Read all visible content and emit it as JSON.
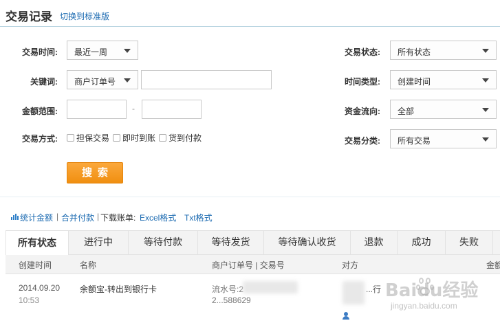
{
  "header": {
    "title": "交易记录",
    "switch_link": "切换到标准版"
  },
  "filters": {
    "time_label": "交易时间:",
    "time_value": "最近一周",
    "keyword_label": "关键词:",
    "keyword_type": "商户订单号",
    "keyword_value": "",
    "amount_label": "金额范围:",
    "amount_min": "",
    "amount_max": "",
    "amount_separator": "-",
    "method_label": "交易方式:",
    "methods": [
      "担保交易",
      "即时到账",
      "货到付款"
    ],
    "status_label": "交易状态:",
    "status_value": "所有状态",
    "timetype_label": "时间类型:",
    "timetype_value": "创建时间",
    "flow_label": "资金流向:",
    "flow_value": "全部",
    "category_label": "交易分类:",
    "category_value": "所有交易",
    "search_button": "搜索"
  },
  "toolbar": {
    "stats": "统计金额",
    "sep1": "|",
    "merge_pay": "合并付款",
    "sep2": "|",
    "download_label": "下载账单:",
    "excel": "Excel格式",
    "txt": "Txt格式"
  },
  "tabs": [
    "所有状态",
    "进行中",
    "等待付款",
    "等待发货",
    "等待确认收货",
    "退款",
    "成功",
    "失败"
  ],
  "columns": {
    "created": "创建时间",
    "name": "名称",
    "order": "商户订单号 | 交易号",
    "party": "对方",
    "amount": "金额"
  },
  "rows": [
    {
      "date": "2014.09.20",
      "time": "10:53",
      "name": "余额宝-转出到银行卡",
      "serial": "流水号:2",
      "order_no": "2...588629",
      "party": "...行"
    }
  ],
  "watermark": {
    "text": "Baidu经验",
    "sub": "jingyan.baidu.com"
  },
  "colors": {
    "accent": "#f08f10",
    "link": "#1b6ab1",
    "header_border": "#b7d3e0"
  }
}
